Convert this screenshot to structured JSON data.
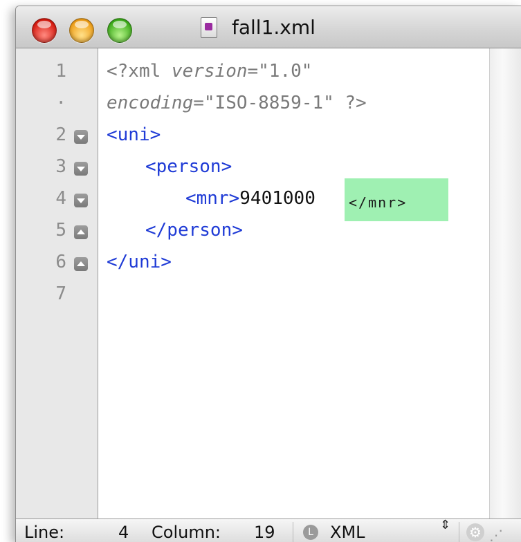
{
  "window": {
    "title": "fall1.xml"
  },
  "gutter": {
    "line_numbers": [
      "1",
      "·",
      "2",
      "3",
      "4",
      "5",
      "6",
      "7"
    ]
  },
  "editor": {
    "lines": [
      {
        "pre": "<?xml ",
        "attr1": "version",
        "mid1": "=\"1.0\""
      },
      {
        "attr2": "encoding",
        "mid2": "=\"ISO-8859-1\" ?>"
      },
      {
        "tag": "<uni>"
      },
      {
        "tag": "<person>"
      },
      {
        "tag": "<mnr>",
        "value": "9401000",
        "autoclose": "</mnr>"
      },
      {
        "tag": "</person>"
      },
      {
        "tag": "</uni>"
      }
    ],
    "highlight_color": "#9ff0b2",
    "tag_color": "#1f3bd6"
  },
  "statusbar": {
    "line_label": "Line:",
    "line_value": "4",
    "column_label": "Column:",
    "column_value": "19",
    "language_icon": "L",
    "language": "XML",
    "updown_icon": "⇕",
    "gear_icon": "⚙",
    "resize_icon": "⋰"
  }
}
